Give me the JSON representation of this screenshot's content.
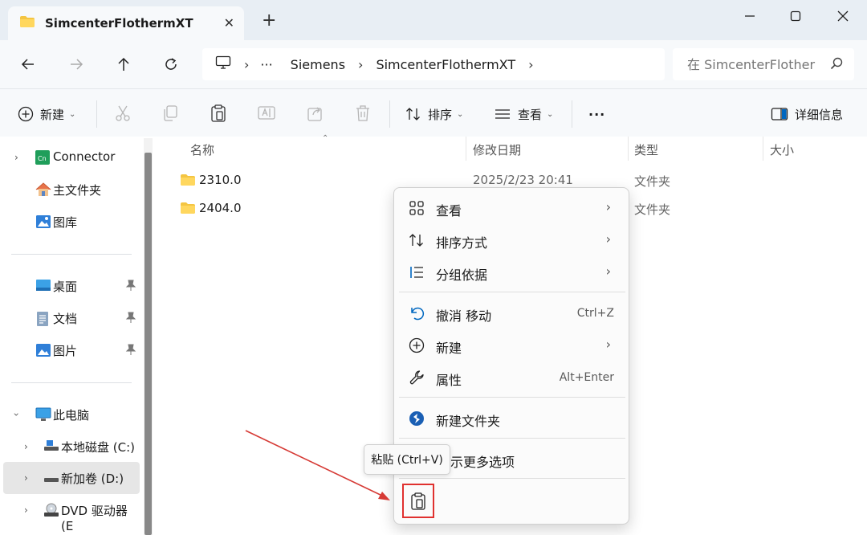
{
  "tab": {
    "title": "SimcenterFlothermXT",
    "close": "✕",
    "new_tab": "+"
  },
  "window_controls": {
    "minimize": "minimize",
    "maximize": "maximize",
    "close": "close"
  },
  "address": {
    "more": "···",
    "crumbs": [
      "Siemens",
      "SimcenterFlothermXT"
    ],
    "separator": "›"
  },
  "search": {
    "placeholder": "在 SimcenterFlother"
  },
  "toolbar": {
    "new_label": "新建",
    "sort_label": "排序",
    "view_label": "查看",
    "more_label": "···",
    "details_label": "详细信息"
  },
  "sidebar": {
    "items": [
      {
        "label": "Connector",
        "icon": "connector-icon"
      },
      {
        "label": "主文件夹",
        "icon": "home-icon"
      },
      {
        "label": "图库",
        "icon": "gallery-icon"
      },
      {
        "label": "桌面",
        "icon": "desktop-icon"
      },
      {
        "label": "文档",
        "icon": "documents-icon"
      },
      {
        "label": "图片",
        "icon": "pictures-icon"
      },
      {
        "label": "此电脑",
        "icon": "this-pc-icon"
      },
      {
        "label": "本地磁盘 (C:)",
        "icon": "drive-icon"
      },
      {
        "label": "新加卷 (D:)",
        "icon": "drive-icon"
      },
      {
        "label": "DVD 驱动器 (E",
        "icon": "dvd-icon"
      }
    ]
  },
  "columns": {
    "name": "名称",
    "date": "修改日期",
    "type": "类型",
    "size": "大小"
  },
  "files": [
    {
      "name": "2310.0",
      "date": "2025/2/23 20:41",
      "type": "文件夹"
    },
    {
      "name": "2404.0",
      "date": "",
      "type": "文件夹"
    }
  ],
  "context_menu": {
    "items": [
      {
        "label": "查看",
        "submenu": "›"
      },
      {
        "label": "排序方式",
        "submenu": "›"
      },
      {
        "label": "分组依据",
        "submenu": "›"
      },
      {
        "label": "撤消 移动",
        "shortcut": "Ctrl+Z"
      },
      {
        "label": "新建",
        "submenu": "›"
      },
      {
        "label": "属性",
        "shortcut": "Alt+Enter"
      },
      {
        "label": "新建文件夹"
      },
      {
        "label": "示更多选项"
      }
    ]
  },
  "tooltip": {
    "text": "粘贴 (Ctrl+V)"
  },
  "colors": {
    "accent": "#0067c0",
    "folder": "#f4c542",
    "highlight": "#e0312f",
    "arrow": "#d63a35"
  }
}
